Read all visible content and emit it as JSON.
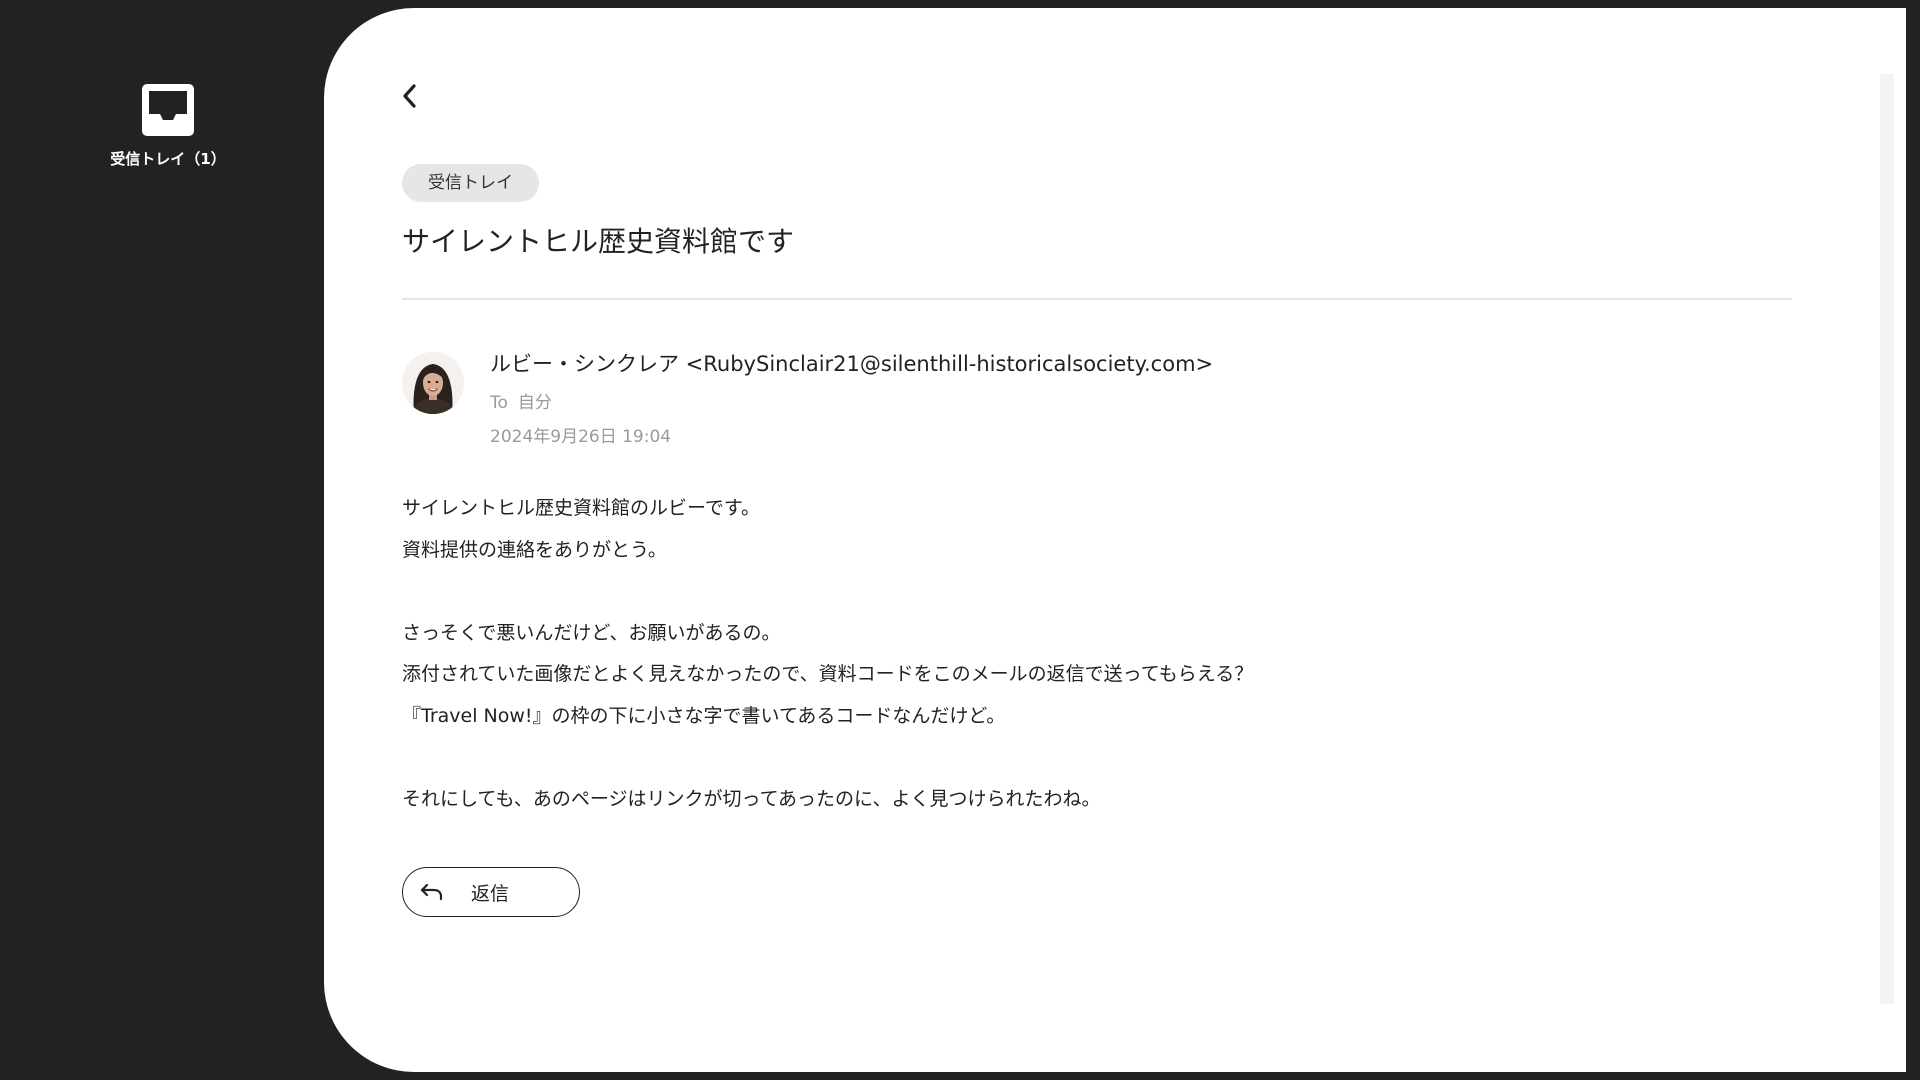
{
  "sidebar": {
    "inbox": {
      "label": "受信トレイ（1）",
      "icon": "inbox-tray-icon"
    }
  },
  "email": {
    "back_icon": "chevron-left-icon",
    "folder_label": "受信トレイ",
    "subject": "サイレントヒル歴史資料館です",
    "sender": "ルビー・シンクレア <RubySinclair21@silenthill-historicalsociety.com>",
    "to_prefix": "To",
    "to_value": "自分",
    "date": "2024年9月26日 19:04",
    "body_lines": [
      "サイレントヒル歴史資料館のルビーです。",
      "資料提供の連絡をありがとう。",
      "",
      "さっそくで悪いんだけど、お願いがあるの。",
      "添付されていた画像だとよく見えなかったので、資料コードをこのメールの返信で送ってもらえる？",
      "『Travel Now!』の枠の下に小さな字で書いてあるコードなんだけど。",
      "",
      "それにしても、あのページはリンクが切ってあったのに、よく見つけられたわね。"
    ],
    "reply_label": "返信",
    "reply_icon": "reply-arrow-icon"
  },
  "colors": {
    "sidebar_bg": "#222222",
    "panel_bg": "#ffffff",
    "chip_bg": "#e6e6e6",
    "muted_text": "#9a9a9a"
  }
}
